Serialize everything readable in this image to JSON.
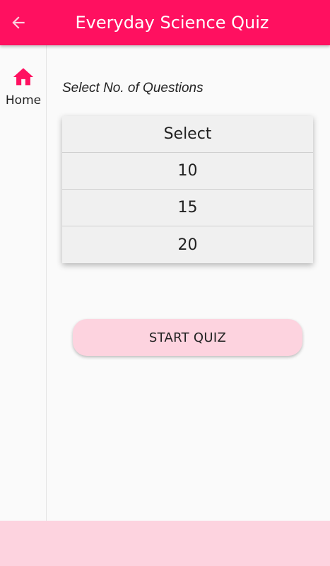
{
  "app": {
    "title": "Everyday Science Quiz",
    "accent_color": "#ff1060",
    "back_icon": "arrow-left-icon"
  },
  "nav": {
    "items": [
      {
        "label": "Home",
        "icon": "home-icon"
      }
    ]
  },
  "main": {
    "prompt": "Select No. of Questions",
    "options": [
      "Select",
      "10",
      "15",
      "20"
    ],
    "start_button": "START QUIZ"
  },
  "colors": {
    "app_bar": "#ff1060",
    "button_bg": "#fdd3df",
    "bottom_bar": "#fdd3df"
  }
}
